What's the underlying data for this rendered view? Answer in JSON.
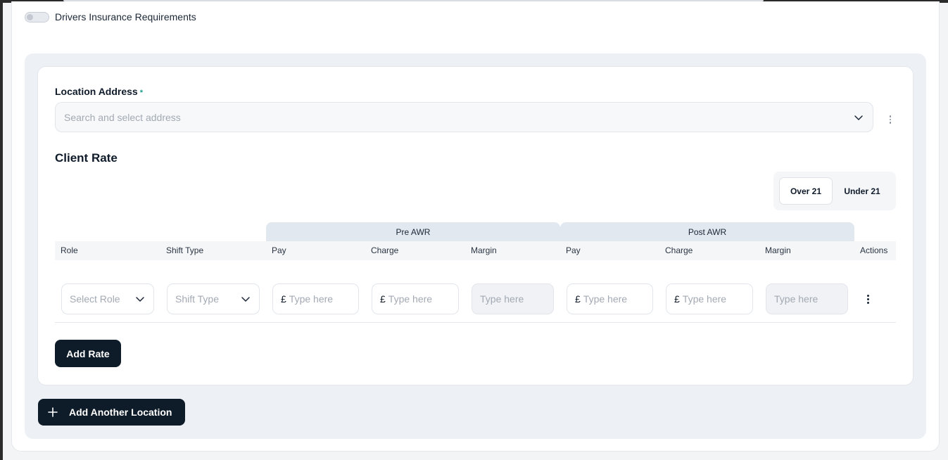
{
  "toggle": {
    "label": "Drivers Insurance Requirements",
    "on": false
  },
  "location": {
    "label": "Location Address",
    "required_mark": "*",
    "placeholder": "Search and select address"
  },
  "client_rate": {
    "title": "Client Rate",
    "segments": [
      {
        "label": "Over 21",
        "active": true
      },
      {
        "label": "Under 21",
        "active": false
      }
    ],
    "groups": {
      "pre": "Pre AWR",
      "post": "Post AWR"
    },
    "columns": [
      "Role",
      "Shift Type",
      "Pay",
      "Charge",
      "Margin",
      "Pay",
      "Charge",
      "Margin",
      "Actions"
    ],
    "row": {
      "role_placeholder": "Select Role",
      "shift_placeholder": "Shift Type",
      "currency": "£",
      "input_placeholder": "Type here",
      "margin_placeholder": "Type here"
    },
    "add_rate_label": "Add Rate"
  },
  "add_location_label": "Add Another Location"
}
